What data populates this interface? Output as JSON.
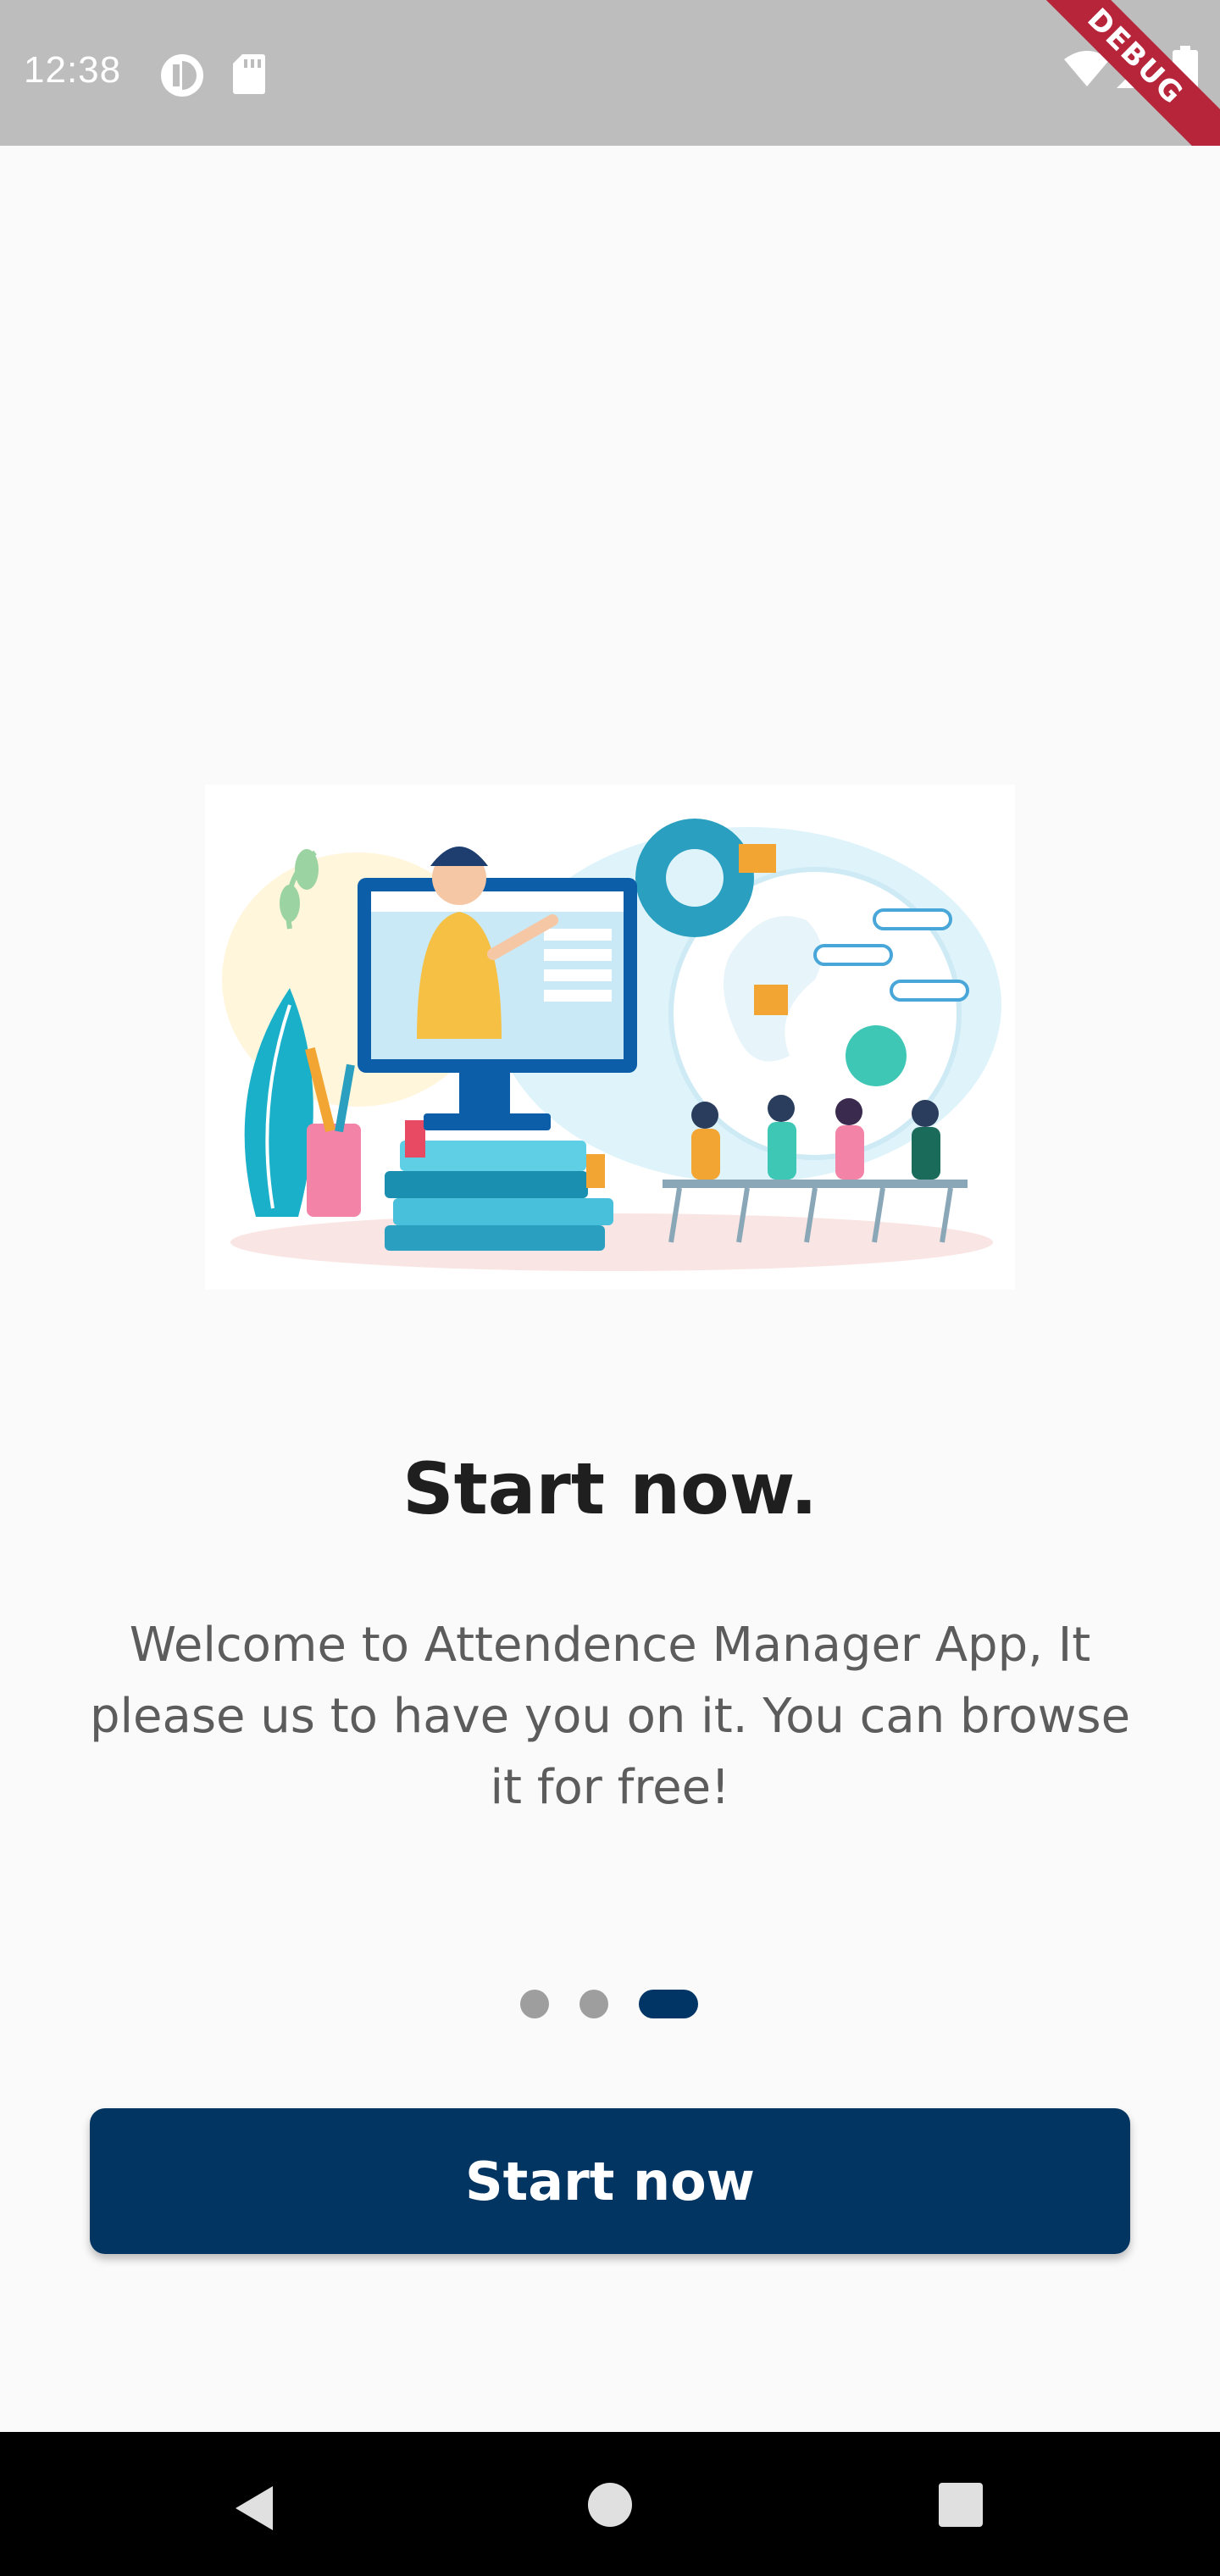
{
  "status_bar": {
    "time": "12:38",
    "left_icons": [
      "app-notification-icon",
      "sd-card-icon"
    ],
    "right_icons": [
      "wifi-icon",
      "signal-icon",
      "battery-icon"
    ],
    "debug_label": "DEBUG"
  },
  "onboarding": {
    "illustration": "online-class-illustration",
    "title": "Start now.",
    "description": "Welcome to Attendence Manager App, It please us to have you on it. You can browse it for free!",
    "page_indicator": {
      "pages": 3,
      "current": 3
    },
    "button_label": "Start now"
  },
  "nav_bar": {
    "icons": [
      "back-icon",
      "home-icon",
      "recents-icon"
    ]
  },
  "colors": {
    "primary": "#033563",
    "status_bar": "#bdbdbd",
    "background": "#fafafa",
    "inactive_dot": "#9e9e9e",
    "debug_banner": "#b7253b"
  }
}
